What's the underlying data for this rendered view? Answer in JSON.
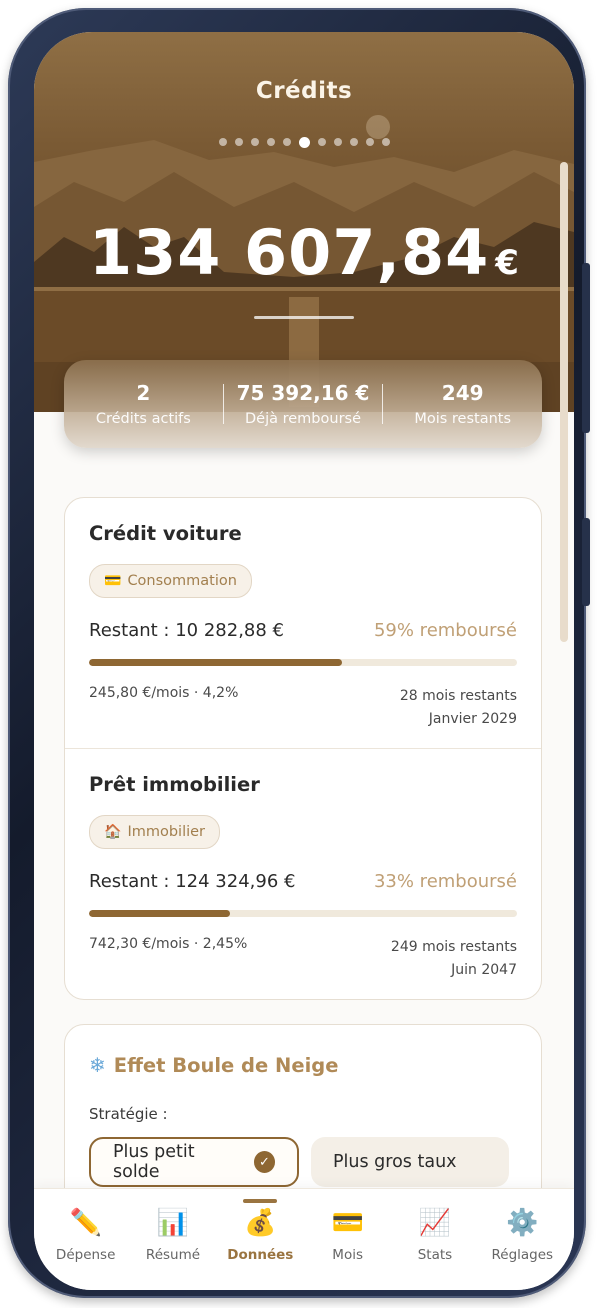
{
  "header": {
    "title": "Crédits",
    "page_dots": 11,
    "active_dot": 5,
    "total_amount": "134 607,84",
    "currency": "€"
  },
  "summary": {
    "items": [
      {
        "value": "2",
        "label": "Crédits actifs"
      },
      {
        "value": "75 392,16 €",
        "label": "Déjà remboursé"
      },
      {
        "value": "249",
        "label": "Mois restants"
      }
    ]
  },
  "loans": [
    {
      "title": "Crédit voiture",
      "tag_icon": "💳",
      "tag": "Consommation",
      "remaining": "Restant : 10 282,88 €",
      "percent_label": "59% remboursé",
      "progress": 0.59,
      "monthly": "245,80 €/mois · 4,2%",
      "months_left": "28 mois restants",
      "end_date": "Janvier 2029"
    },
    {
      "title": "Prêt immobilier",
      "tag_icon": "🏠",
      "tag": "Immobilier",
      "remaining": "Restant : 124 324,96 €",
      "percent_label": "33% remboursé",
      "progress": 0.33,
      "monthly": "742,30 €/mois · 2,45%",
      "months_left": "249 mois restants",
      "end_date": "Juin 2047"
    }
  ],
  "snowball": {
    "icon": "❄",
    "title": "Effet Boule de Neige",
    "strategy_label": "Stratégie :",
    "option_selected": "Plus petit solde",
    "option_other": "Plus gros taux"
  },
  "nav": {
    "active": "Données",
    "items": [
      {
        "icon": "✏️",
        "label": "Dépense"
      },
      {
        "icon": "📊",
        "label": "Résumé"
      },
      {
        "icon": "💰",
        "label": "Données"
      },
      {
        "icon": "💳",
        "label": "Mois"
      },
      {
        "icon": "📈",
        "label": "Stats"
      },
      {
        "icon": "⚙️",
        "label": "Réglages"
      }
    ]
  },
  "colors": {
    "accent": "#8e6733",
    "accent_light": "#c0a076",
    "header_brown": "#7a5a34"
  }
}
